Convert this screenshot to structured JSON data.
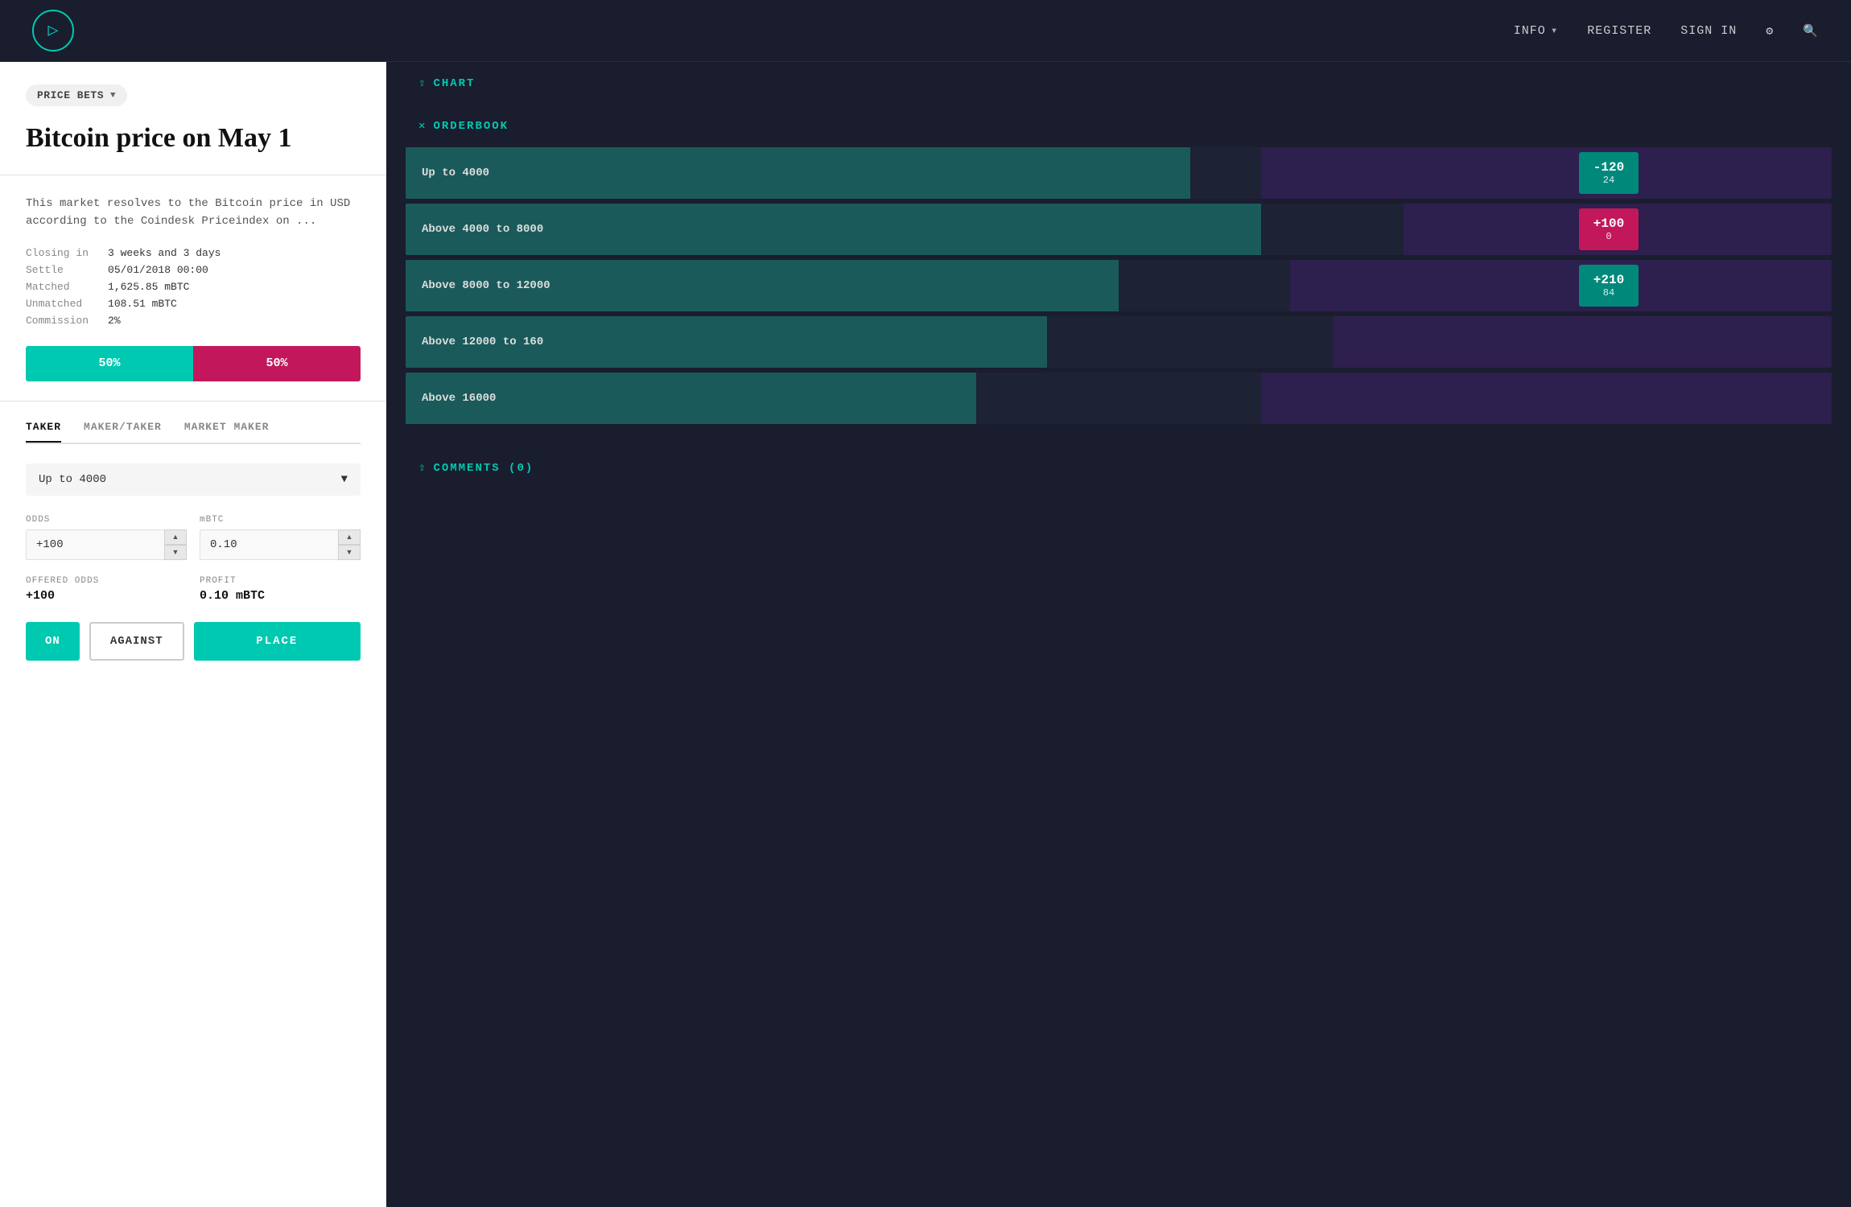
{
  "navbar": {
    "logo_icon": "F",
    "info_label": "INFO",
    "register_label": "REGISTER",
    "signin_label": "SIGN IN",
    "gear_icon": "⚙",
    "search_icon": "🔍"
  },
  "left_panel": {
    "badge_label": "PRICE BETS",
    "market_title": "Bitcoin price on May 1",
    "description": "This market resolves to the Bitcoin price in USD according to the Coindesk Priceindex on ...",
    "closing_label": "Closing in",
    "closing_value": "3 weeks and 3 days",
    "settle_label": "Settle",
    "settle_value": "05/01/2018 00:00",
    "matched_label": "Matched",
    "matched_value": "1,625.85 mBTC",
    "unmatched_label": "Unmatched",
    "unmatched_value": "108.51 mBTC",
    "commission_label": "Commission",
    "commission_value": "2%",
    "progress_yes_pct": 50,
    "progress_yes_label": "50%",
    "progress_no_label": "50%",
    "progress_yes_color": "#00c9b1",
    "progress_no_color": "#c2185b",
    "tabs": [
      "TAKER",
      "MAKER/TAKER",
      "MARKET MAKER"
    ],
    "active_tab": 0,
    "select_label": "Up to 4000",
    "odds_label": "ODDS",
    "odds_value": "+100",
    "mbtc_label": "mBTC",
    "mbtc_value": "0.10",
    "offered_odds_label": "OFFERED ODDS",
    "offered_odds_value": "+100",
    "profit_label": "PROFIT",
    "profit_value": "0.10 mBTC",
    "btn_on": "ON",
    "btn_against": "AGAINST",
    "btn_place": "PLACE"
  },
  "right_panel": {
    "chart_label": "CHART",
    "orderbook_label": "ORDERBOOK",
    "comments_label": "COMMENTS (0)",
    "orders": [
      {
        "label": "Up to 4000",
        "badge_value": "-120",
        "badge_sub": "24",
        "badge_type": "teal",
        "bar_teal_pct": 55,
        "bar_purple_pct": 40
      },
      {
        "label": "Above 4000 to 8000",
        "badge_value": "+100",
        "badge_sub": "0",
        "badge_type": "pink",
        "bar_teal_pct": 60,
        "bar_purple_pct": 30
      },
      {
        "label": "Above 8000 to 12000",
        "badge_value": "+210",
        "badge_sub": "84",
        "badge_type": "teal",
        "bar_teal_pct": 50,
        "bar_purple_pct": 38
      },
      {
        "label": "Above 12000 to 160",
        "badge_value": "",
        "badge_sub": "",
        "badge_type": "none",
        "bar_teal_pct": 45,
        "bar_purple_pct": 35
      },
      {
        "label": "Above 16000",
        "badge_value": "",
        "badge_sub": "",
        "badge_type": "none",
        "bar_teal_pct": 40,
        "bar_purple_pct": 40
      }
    ]
  }
}
